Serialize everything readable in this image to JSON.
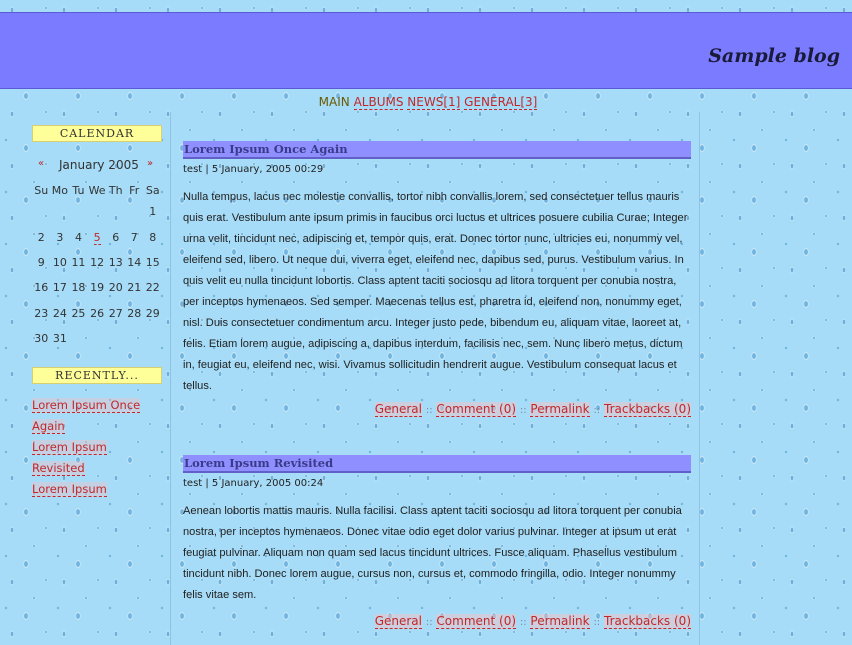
{
  "blog": {
    "title": "Sample blog"
  },
  "nav": {
    "main": "MAIN",
    "albums": "ALBUMS",
    "news": "NEWS[1]",
    "general": "GENERAL[3]"
  },
  "calendar": {
    "heading": "CALENDAR",
    "prev": "«",
    "next": "»",
    "month": "January 2005",
    "weekdays": [
      "Su",
      "Mo",
      "Tu",
      "We",
      "Th",
      "Fr",
      "Sa"
    ],
    "weeks": [
      [
        "",
        "",
        "",
        "",
        "",
        "",
        "1"
      ],
      [
        "2",
        "3",
        "4",
        "5",
        "6",
        "7",
        "8"
      ],
      [
        "9",
        "10",
        "11",
        "12",
        "13",
        "14",
        "15"
      ],
      [
        "16",
        "17",
        "18",
        "19",
        "20",
        "21",
        "22"
      ],
      [
        "23",
        "24",
        "25",
        "26",
        "27",
        "28",
        "29"
      ],
      [
        "30",
        "31",
        "",
        "",
        "",
        "",
        ""
      ]
    ],
    "today": "5"
  },
  "recent": {
    "heading": "RECENTLY...",
    "items": [
      "Lorem Ipsum Once Again",
      "Lorem Ipsum Revisited",
      "Lorem Ipsum"
    ]
  },
  "posts": [
    {
      "title": "Lorem Ipsum Once Again",
      "meta": "test | 5 January, 2005 00:29",
      "body": "Nulla tempus, lacus nec molestie convallis, tortor nibh convallis lorem, sed consectetuer tellus mauris quis erat. Vestibulum ante ipsum primis in faucibus orci luctus et ultrices posuere cubilia Curae; Integer urna velit, tincidunt nec, adipiscing et, tempor quis, erat. Donec tortor nunc, ultricies eu, nonummy vel, eleifend sed, libero. Ut neque dui, viverra eget, eleifend nec, dapibus sed, purus. Vestibulum varius. In quis velit eu nulla tincidunt lobortis. Class aptent taciti sociosqu ad litora torquent per conubia nostra, per inceptos hymenaeos. Sed semper. Maecenas tellus est, pharetra id, eleifend non, nonummy eget, nisl. Duis consectetuer condimentum arcu. Integer justo pede, bibendum eu, aliquam vitae, laoreet at, felis. Etiam lorem augue, adipiscing a, dapibus interdum, facilisis nec, sem. Nunc libero metus, dictum in, feugiat eu, eleifend nec, wisi. Vivamus sollicitudin hendrerit augue. Vestibulum consequat lacus et tellus.",
      "category": "General",
      "comments": "Comment (0)",
      "permalink": "Permalink",
      "trackbacks": "Trackbacks (0)"
    },
    {
      "title": "Lorem Ipsum Revisited",
      "meta": "test | 5 January, 2005 00:24",
      "body": "Aenean lobortis mattis mauris. Nulla facilisi. Class aptent taciti sociosqu ad litora torquent per conubia nostra, per inceptos hymenaeos. Donec vitae odio eget dolor varius pulvinar. Integer at ipsum ut erat feugiat pulvinar. Aliquam non quam sed lacus tincidunt ultrices. Fusce aliquam. Phasellus vestibulum tincidunt nibh. Donec lorem augue, cursus non, cursus et, commodo fringilla, odio. Integer nonummy felis vitae sem.",
      "category": "General",
      "comments": "Comment (0)",
      "permalink": "Permalink",
      "trackbacks": "Trackbacks (0)"
    }
  ],
  "separator": "::",
  "colors": {
    "header": "#7b7bff",
    "post_title_bar": "#8f8fff",
    "link": "#c0282a",
    "side_heading": "#ffff99",
    "background": "#a6dcf7"
  }
}
